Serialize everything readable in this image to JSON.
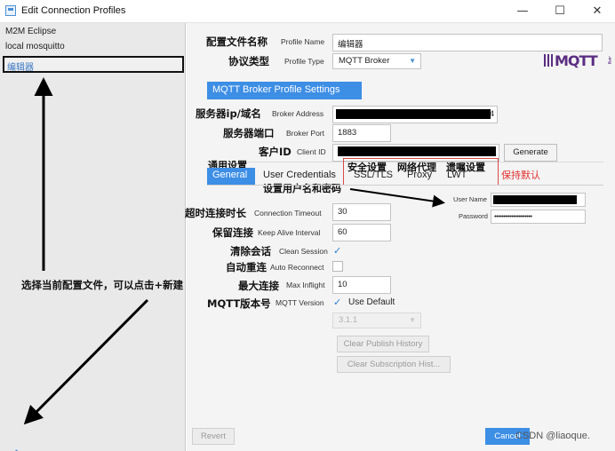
{
  "window": {
    "title": "Edit Connection Profiles",
    "minimize_glyph": "—",
    "maximize_glyph": "☐",
    "close_glyph": "✕"
  },
  "sidebar": {
    "profiles": [
      "M2M Eclipse",
      "local mosquitto"
    ],
    "selected_profile": "编辑器",
    "add_glyph": "+",
    "remove_glyph": "−"
  },
  "profile": {
    "name_cn": "配置文件名称",
    "name_en": "Profile Name",
    "name_value": "编辑器",
    "type_cn": "协议类型",
    "type_en": "Profile Type",
    "type_value": "MQTT Broker",
    "logo_text": "MQTT",
    "logo_org": ".org"
  },
  "broker": {
    "heading": "MQTT Broker Profile Settings",
    "address_cn": "服务器ip/域名",
    "address_en": "Broker Address",
    "address_tail": "4",
    "port_cn": "服务器端口",
    "port_en": "Broker Port",
    "port_value": "1883",
    "client_cn": "客户ID",
    "client_en": "Client ID",
    "generate_label": "Generate"
  },
  "tabs": {
    "general_cn": "通用设置",
    "general": "General",
    "credentials": "User Credentials",
    "credentials_cn": "设置用户名和密码",
    "ssl_cn": "安全设置",
    "ssl": "SSL/TLS",
    "proxy_cn": "网络代理",
    "proxy": "Proxy",
    "lwt_cn": "遗嘱设置",
    "lwt": "LWT",
    "keep_default": "保持默认"
  },
  "credentials": {
    "username_label": "User Name",
    "password_label": "Password",
    "password_value": "••••••••••••••••••••"
  },
  "general": {
    "timeout_cn": "超时连接时长",
    "timeout_en": "Connection Timeout",
    "timeout_value": "30",
    "keepalive_cn": "保留连接",
    "keepalive_en": "Keep Alive Interval",
    "keepalive_value": "60",
    "clean_cn": "清除会话",
    "clean_en": "Clean Session",
    "reconnect_cn": "自动重连",
    "reconnect_en": "Auto Reconnect",
    "inflight_cn": "最大连接",
    "inflight_en": "Max Inflight",
    "inflight_value": "10",
    "version_cn": "MQTT版本号",
    "version_en": "MQTT Version",
    "use_default": "Use Default",
    "version_value": "3.1.1",
    "clear_publish": "Clear Publish History",
    "clear_subscription": "Clear Subscription Hist..."
  },
  "footer": {
    "revert": "Revert",
    "cancel": "Cancel"
  },
  "annotations": {
    "sidebar_note": "选择当前配置文件，可以点击+新建",
    "watermark": "CSDN @liaoque."
  },
  "colors": {
    "accent": "#3d8ee5",
    "annotation_red": "#e03030",
    "logo_purple": "#5a2d82"
  }
}
